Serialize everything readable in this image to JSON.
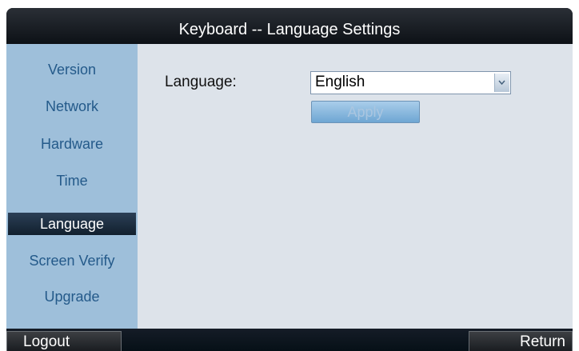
{
  "header": {
    "title": "Keyboard -- Language Settings"
  },
  "sidebar": {
    "items": [
      {
        "label": "Version"
      },
      {
        "label": "Network"
      },
      {
        "label": "Hardware"
      },
      {
        "label": "Time"
      },
      {
        "label": "Language"
      },
      {
        "label": "Screen Verify"
      },
      {
        "label": "Upgrade"
      }
    ],
    "active": "Language"
  },
  "main": {
    "language_label": "Language:",
    "language_select": {
      "value": "English"
    },
    "apply_label": "Apply",
    "apply_enabled": false
  },
  "footer": {
    "logout_label": "Logout",
    "return_label": "Return"
  },
  "colors": {
    "sidebar_bg": "#9ebfda",
    "sidebar_text": "#245a8a",
    "content_bg": "#dde3ea",
    "active_item_bg": "#1c2c3d",
    "apply_bg": "#8bbbe0"
  },
  "icons": {
    "select_arrow": "chevron-down-icon"
  }
}
